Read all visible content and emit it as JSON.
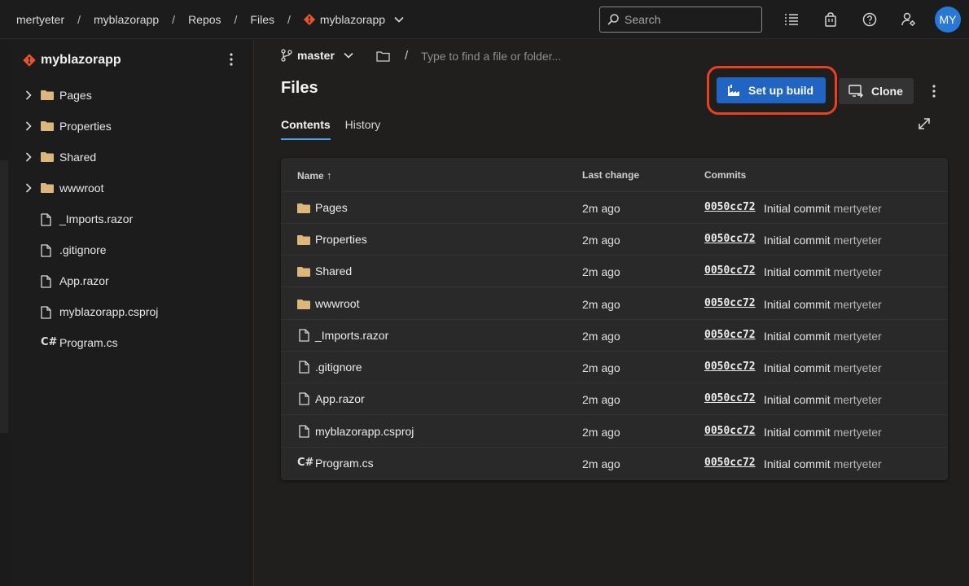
{
  "breadcrumb": {
    "items": [
      "mertyeter",
      "myblazorapp",
      "Repos",
      "Files"
    ],
    "repo": "myblazorapp",
    "separator": "/"
  },
  "search": {
    "placeholder": "Search"
  },
  "user": {
    "initials": "MY"
  },
  "colors": {
    "accent": "#2165c4",
    "highlight": "#e8411e",
    "git": "#e8542b",
    "folder": "#dcb67a"
  },
  "sidebar": {
    "title": "myblazorapp",
    "items": [
      {
        "label": "Pages",
        "type": "folder"
      },
      {
        "label": "Properties",
        "type": "folder"
      },
      {
        "label": "Shared",
        "type": "folder"
      },
      {
        "label": "wwwroot",
        "type": "folder"
      },
      {
        "label": "_Imports.razor",
        "type": "file"
      },
      {
        "label": ".gitignore",
        "type": "file"
      },
      {
        "label": "App.razor",
        "type": "file"
      },
      {
        "label": "myblazorapp.csproj",
        "type": "file"
      },
      {
        "label": "Program.cs",
        "type": "csharp"
      }
    ]
  },
  "main": {
    "branch": "master",
    "path_separator": "/",
    "path_placeholder": "Type to find a file or folder...",
    "title": "Files",
    "setup_build_label": "Set up build",
    "clone_label": "Clone",
    "tabs": [
      {
        "label": "Contents",
        "active": true
      },
      {
        "label": "History",
        "active": false
      }
    ]
  },
  "table": {
    "columns": {
      "name": "Name",
      "sort_indicator": "↑",
      "last_change": "Last change",
      "commits": "Commits"
    },
    "rows": [
      {
        "name": "Pages",
        "type": "folder",
        "last_change": "2m ago",
        "hash": "0050cc72",
        "message": "Initial commit",
        "author": "mertyeter"
      },
      {
        "name": "Properties",
        "type": "folder",
        "last_change": "2m ago",
        "hash": "0050cc72",
        "message": "Initial commit",
        "author": "mertyeter"
      },
      {
        "name": "Shared",
        "type": "folder",
        "last_change": "2m ago",
        "hash": "0050cc72",
        "message": "Initial commit",
        "author": "mertyeter"
      },
      {
        "name": "wwwroot",
        "type": "folder",
        "last_change": "2m ago",
        "hash": "0050cc72",
        "message": "Initial commit",
        "author": "mertyeter"
      },
      {
        "name": "_Imports.razor",
        "type": "file",
        "last_change": "2m ago",
        "hash": "0050cc72",
        "message": "Initial commit",
        "author": "mertyeter"
      },
      {
        "name": ".gitignore",
        "type": "file",
        "last_change": "2m ago",
        "hash": "0050cc72",
        "message": "Initial commit",
        "author": "mertyeter"
      },
      {
        "name": "App.razor",
        "type": "file",
        "last_change": "2m ago",
        "hash": "0050cc72",
        "message": "Initial commit",
        "author": "mertyeter"
      },
      {
        "name": "myblazorapp.csproj",
        "type": "file",
        "last_change": "2m ago",
        "hash": "0050cc72",
        "message": "Initial commit",
        "author": "mertyeter"
      },
      {
        "name": "Program.cs",
        "type": "csharp",
        "last_change": "2m ago",
        "hash": "0050cc72",
        "message": "Initial commit",
        "author": "mertyeter"
      }
    ]
  }
}
